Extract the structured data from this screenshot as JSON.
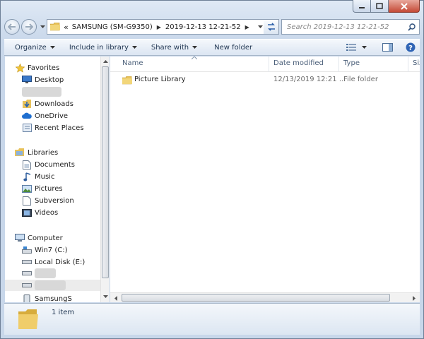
{
  "window": {
    "title": "",
    "buttons": [
      "minimize",
      "maximize",
      "close"
    ]
  },
  "address": {
    "overflow": "«",
    "crumbs": [
      {
        "label": "SAMSUNG (SM-G9350)"
      },
      {
        "label": "2019-12-13 12-21-52"
      }
    ]
  },
  "search": {
    "placeholder": "Search 2019-12-13 12-21-52"
  },
  "toolbar": {
    "organize": "Organize",
    "include_in_library": "Include in library",
    "share_with": "Share with",
    "new_folder": "New folder"
  },
  "navpane": {
    "favorites": "Favorites",
    "desktop": "Desktop",
    "downloads": "Downloads",
    "onedrive": "OneDrive",
    "recent_places": "Recent Places",
    "libraries": "Libraries",
    "documents": "Documents",
    "music": "Music",
    "pictures": "Pictures",
    "subversion": "Subversion",
    "videos": "Videos",
    "computer": "Computer",
    "win7": "Win7 (C:)",
    "local_disk": "Local Disk (E:)",
    "samsungs": "SamsungS"
  },
  "columns": {
    "name": "Name",
    "date_modified": "Date modified",
    "type": "Type",
    "size": "Size"
  },
  "files": [
    {
      "name": "Picture Library",
      "date_modified": "12/13/2019 12:21 ...",
      "type": "File folder"
    }
  ],
  "details": {
    "count": "1 item"
  },
  "colors": {
    "folder": "#e8c25a",
    "accent": "#1e3450"
  }
}
